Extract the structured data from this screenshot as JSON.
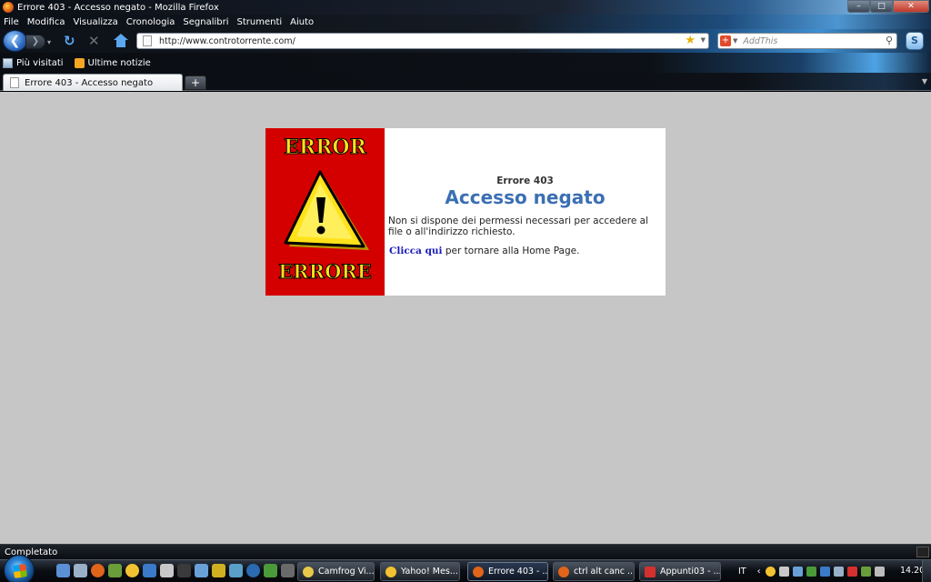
{
  "window": {
    "title": "Errore 403 - Accesso negato - Mozilla Firefox",
    "controls": {
      "minimize": "–",
      "maximize": "□",
      "close": "✕"
    }
  },
  "menu": {
    "items": [
      "File",
      "Modifica",
      "Visualizza",
      "Cronologia",
      "Segnalibri",
      "Strumenti",
      "Aiuto"
    ]
  },
  "navbar": {
    "back": "❮",
    "forward": "❯",
    "reload": "↻",
    "stop": "✕",
    "url": "http://www.controtorrente.com/",
    "star": "★",
    "search_placeholder": "AddThis",
    "search_go": "⚲",
    "search_engine_glyph": "+",
    "skype_glyph": "S"
  },
  "bookmarks": [
    {
      "label": "Più visitati",
      "icon": "most-visited-icon"
    },
    {
      "label": "Ultime notizie",
      "icon": "rss-feed-icon"
    }
  ],
  "tabs": {
    "active_title": "Errore 403 - Accesso negato",
    "new_tab": "+"
  },
  "page": {
    "image_top_word": "ERROR",
    "image_bottom_word": "ERRORE",
    "code": "Errore 403",
    "title": "Accesso negato",
    "description": "Non si dispone dei permessi necessari per accedere al file o all'indirizzo richiesto.",
    "link_label": "Clicca qui",
    "link_suffix": " per tornare alla Home Page.",
    "colors": {
      "background": "#c6c6c6",
      "title": "#3b6fb3",
      "link": "#1a1ab8",
      "image_bg": "#d40000",
      "warning_yellow": "#ffe21a"
    }
  },
  "status": {
    "text": "Completato"
  },
  "taskbar": {
    "buttons": [
      {
        "label": "Camfrog Vi...",
        "icon_color": "#e8c94a"
      },
      {
        "label": "Yahoo! Mes...",
        "icon_color": "#f2c230"
      },
      {
        "label": "Errore 403 - ...",
        "icon_color": "#e0641a"
      },
      {
        "label": "ctrl alt canc ...",
        "icon_color": "#e0641a"
      },
      {
        "label": "Appunti03 - ...",
        "icon_color": "#d43030"
      }
    ],
    "language": "IT",
    "clock": "14.20"
  }
}
